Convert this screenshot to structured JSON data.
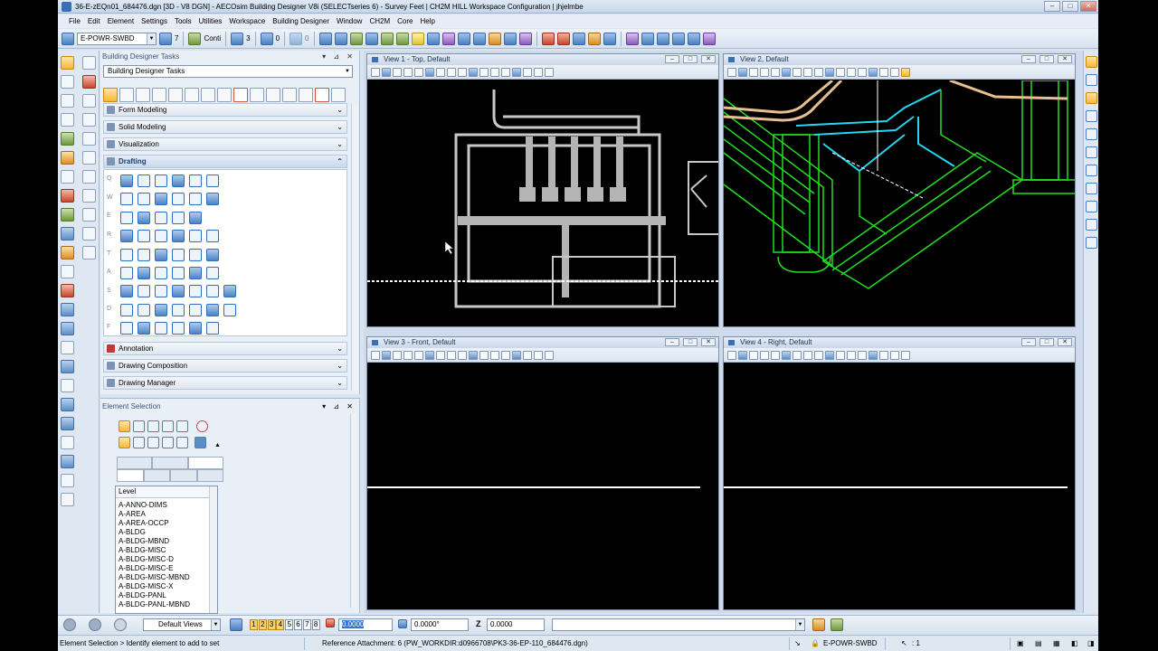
{
  "window": {
    "title": "36-E-zEQn01_684476.dgn [3D - V8 DGN] - AECOsim Building Designer V8i (SELECTseries 6) - Survey Feet  | CH2M HILL Workspace Configuration | jhjelmbe",
    "min": "–",
    "max": "□",
    "close": "✕"
  },
  "menu": [
    "File",
    "Edit",
    "Element",
    "Settings",
    "Tools",
    "Utilities",
    "Workspace",
    "Building Designer",
    "Window",
    "CH2M",
    "Core",
    "Help"
  ],
  "attributes": {
    "level": "E-POWR-SWBD",
    "color": "7",
    "style": "Conti",
    "weight": "3",
    "transparency": "0",
    "priority": "0"
  },
  "task_panel": {
    "title": "Building Designer Tasks",
    "controls": "▾ ⊿ ✕",
    "selected_task": "Building Designer Tasks",
    "sections": [
      {
        "label": "Form Modeling",
        "state": "collapsed"
      },
      {
        "label": "Solid Modeling",
        "state": "collapsed"
      },
      {
        "label": "Visualization",
        "state": "collapsed"
      },
      {
        "label": "Drafting",
        "state": "expanded"
      },
      {
        "label": "Annotation",
        "state": "collapsed"
      },
      {
        "label": "Drawing Composition",
        "state": "collapsed"
      },
      {
        "label": "Drawing Manager",
        "state": "collapsed"
      }
    ],
    "drafting_rows": [
      "Q",
      "W",
      "E",
      "R",
      "T",
      "A",
      "S",
      "D",
      "F"
    ]
  },
  "element_selection": {
    "title": "Element Selection",
    "controls": "▾ ⊿ ✕",
    "list_header": "Level",
    "levels": [
      "A-ANNO-DIMS",
      "A-AREA",
      "A-AREA-OCCP",
      "A-BLDG",
      "A-BLDG-MBND",
      "A-BLDG-MISC",
      "A-BLDG-MISC-D",
      "A-BLDG-MISC-E",
      "A-BLDG-MISC-MBND",
      "A-BLDG-MISC-X",
      "A-BLDG-PANL",
      "A-BLDG-PANL-MBND"
    ]
  },
  "views": [
    {
      "title": "View 1 - Top, Default"
    },
    {
      "title": "View 2, Default"
    },
    {
      "title": "View 3 - Front, Default"
    },
    {
      "title": "View 4 - Right, Default"
    }
  ],
  "view_controls": {
    "min": "–",
    "max": "□",
    "close": "✕"
  },
  "bottom": {
    "view_group": "Default Views",
    "view_numbers": [
      "1",
      "2",
      "3",
      "4",
      "5",
      "6",
      "7",
      "8"
    ],
    "active_views": [
      1,
      2,
      3,
      4
    ],
    "x_value": "0.0000",
    "angle_value": "0.0000°",
    "z_label": "Z",
    "z_value": "0.0000"
  },
  "status": {
    "prompt": "Element Selection > Identify element to add to set",
    "reference": "Reference Attachment: 6 (PW_WORKDIR:d0966708\\PK3-36-EP-110_684476.dgn)",
    "active_level": "E-POWR-SWBD",
    "selection_count": ": 1"
  },
  "colors": {
    "top_view_geometry": "#c8c8c8",
    "iso_green": "#22e022",
    "iso_cyan": "#22d8f0",
    "iso_tan": "#e8c090",
    "selection_highlight": "#f5b73a"
  }
}
